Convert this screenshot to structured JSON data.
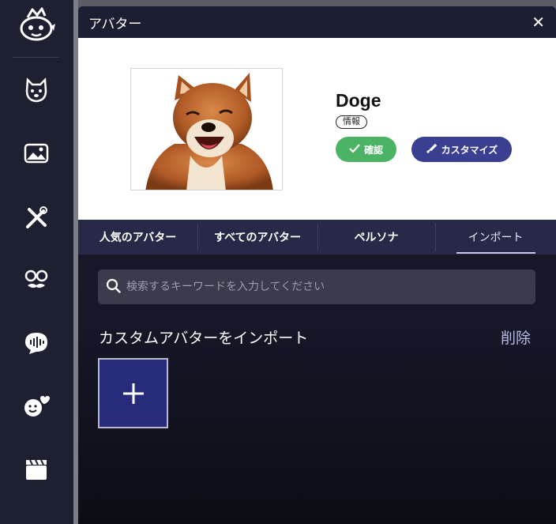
{
  "dialog": {
    "title": "アバター",
    "close_glyph": "✕"
  },
  "avatar": {
    "name": "Doge",
    "info_badge": "情報",
    "confirm_label": "確認",
    "customize_label": "カスタマイズ"
  },
  "tabs": [
    {
      "label": "人気のアバター",
      "active": false
    },
    {
      "label": "すべてのアバター",
      "active": false
    },
    {
      "label": "ペルソナ",
      "active": false
    },
    {
      "label": "インポート",
      "active": true
    }
  ],
  "search": {
    "placeholder": "検索するキーワードを入力してください"
  },
  "import_section": {
    "title": "カスタムアバターをインポート",
    "delete_label": "削除",
    "add_glyph": "+"
  },
  "sidebar": {
    "items": [
      {
        "icon": "mascot-logo-icon"
      },
      {
        "icon": "dog-face-icon"
      },
      {
        "icon": "image-icon"
      },
      {
        "icon": "tools-icon"
      },
      {
        "icon": "mask-glasses-icon"
      },
      {
        "icon": "voice-bubble-icon"
      },
      {
        "icon": "emoji-heart-icon"
      },
      {
        "icon": "clapperboard-icon"
      }
    ]
  },
  "colors": {
    "confirm": "#4bb366",
    "customize": "#3a3f92",
    "tab_bar": "#262a48",
    "add_tile": "#262c7a",
    "delete_link": "#b8bbe6"
  }
}
